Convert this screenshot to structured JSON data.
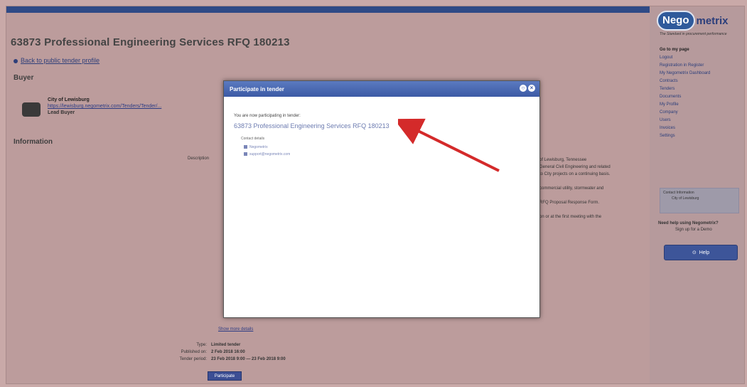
{
  "page": {
    "title": "63873 Professional Engineering Services RFQ 180213",
    "back_link": "Back to public tender profile"
  },
  "buyer": {
    "heading": "Buyer",
    "name": "City of Lewisburg",
    "url": "https://lewisburg.negometrix.com/Tenders/Tender/...",
    "role": "Lead Buyer"
  },
  "information": {
    "heading": "Information",
    "label_description": "Description",
    "right_notes": [
      "of Lewisburg, Tennessee",
      "General Civil Engineering and related",
      "to City projects on a continuing basis.",
      "",
      "commercial utility, stormwater and",
      "",
      "RFQ Proposal Response Form.",
      "",
      "on or at the first meeting with the"
    ],
    "below_link": "Show more details",
    "type_label": "Type:",
    "type_value": "Limited tender",
    "published_label": "Published on:",
    "published_value": "2 Feb 2018 16:00",
    "period_label": "Tender period:",
    "period_value": "23 Feb 2018 9:00 — 23 Feb 2018 9:00",
    "participate_label": "Participate"
  },
  "sidebar": {
    "logo_pill": "Nego",
    "logo_rest": "metrix",
    "tagline": "The Standard in procurement performance",
    "nav": [
      "Go to my page",
      "Logout",
      "Registration in Register",
      "My Negometrix Dashboard",
      "Contracts",
      "Tenders",
      "Documents",
      "My Profile",
      "Company",
      "Users",
      "Invoices",
      "Settings"
    ],
    "box_heading": "Contact Information",
    "box_text": "City of Lewisburg",
    "help_question": "Need help using Negometrix?",
    "help_sub": "Sign up for a Demo",
    "help_button": "Help"
  },
  "modal": {
    "title": "Participate in tender",
    "line1": "You are now participating in tender:",
    "line2": "63873 Professional Engineering Services RFQ 180213",
    "line3": "Contact details",
    "items": [
      "Negometrix",
      "support@negometrix.com"
    ],
    "close_icon_label": "×",
    "settings_icon_label": "○"
  },
  "colors": {
    "accent": "#2f4a86",
    "arrow": "#d42a2a"
  }
}
